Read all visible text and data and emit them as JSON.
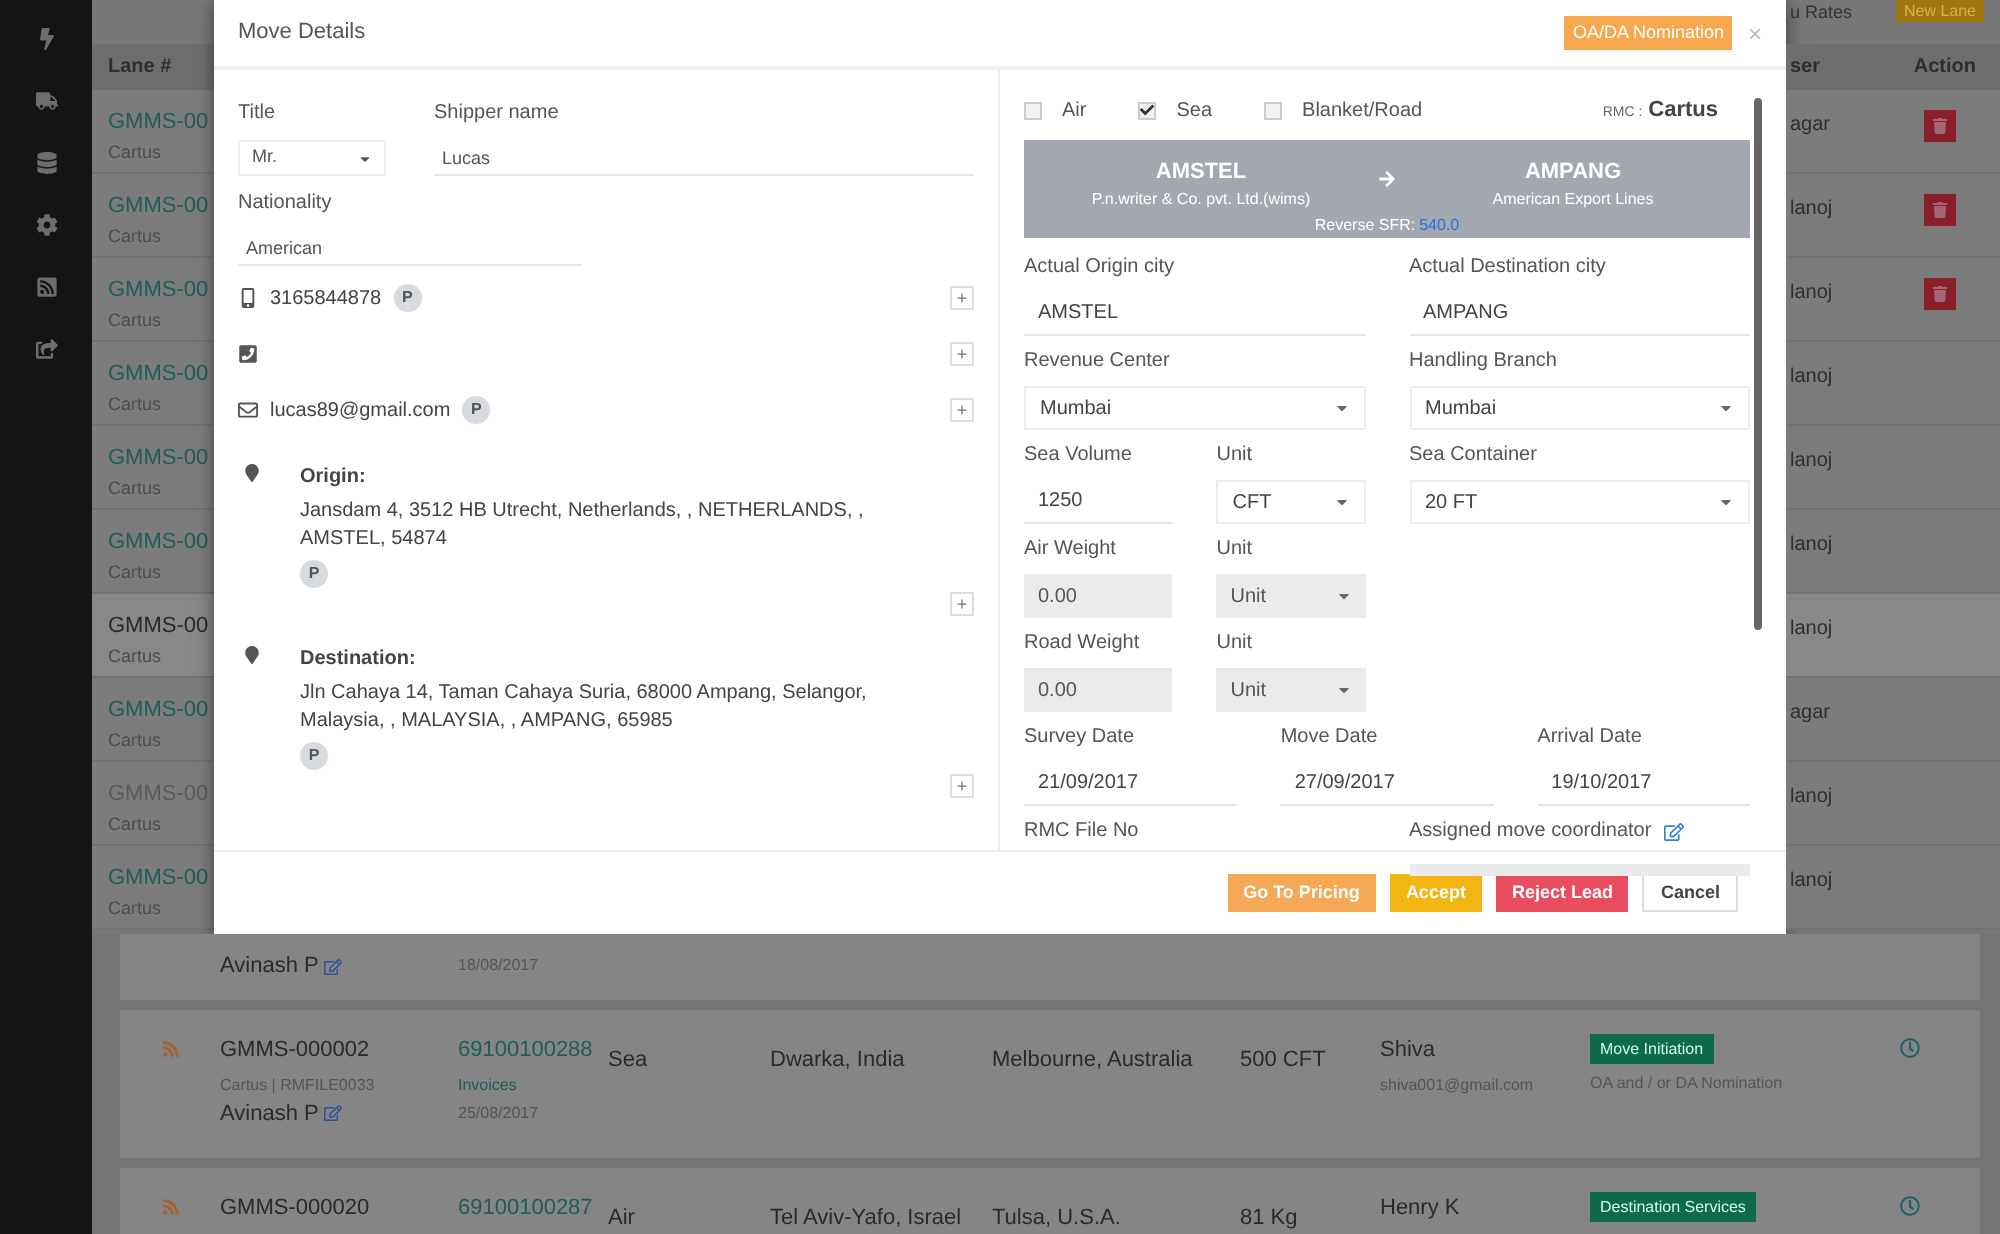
{
  "sidebar": {
    "icons": [
      {
        "kind": "bolt"
      },
      {
        "kind": "truck"
      },
      {
        "kind": "database"
      },
      {
        "kind": "settings"
      },
      {
        "kind": "rss"
      },
      {
        "kind": "share"
      }
    ]
  },
  "top_bar": {
    "rates_text": "u Rates",
    "new_button": "New Lane"
  },
  "background_table": {
    "lane_header": "Lane #",
    "user_header": "ser",
    "action_header": "Action",
    "rows": [
      {
        "lane": "GMMS-00",
        "rmc": "Cartus",
        "user": "agar",
        "kind": "link",
        "deletable": true
      },
      {
        "lane": "GMMS-00",
        "rmc": "Cartus",
        "user": "lanoj",
        "kind": "link",
        "deletable": true
      },
      {
        "lane": "GMMS-00",
        "rmc": "Cartus",
        "user": "lanoj",
        "kind": "link",
        "deletable": true
      },
      {
        "lane": "GMMS-00",
        "rmc": "Cartus",
        "user": "lanoj",
        "kind": "link",
        "deletable": false
      },
      {
        "lane": "GMMS-00",
        "rmc": "Cartus",
        "user": "lanoj",
        "kind": "link",
        "deletable": false
      },
      {
        "lane": "GMMS-00",
        "rmc": "Cartus",
        "user": "lanoj",
        "kind": "link",
        "deletable": false
      },
      {
        "lane": "GMMS-00",
        "rmc": "Cartus",
        "user": "lanoj",
        "kind": "highlight",
        "deletable": false
      },
      {
        "lane": "GMMS-00",
        "rmc": "Cartus",
        "user": "agar",
        "kind": "link",
        "deletable": false
      },
      {
        "lane": "GMMS-00",
        "rmc": "Cartus",
        "user": "lanoj",
        "kind": "muted",
        "deletable": false
      },
      {
        "lane": "GMMS-00",
        "rmc": "Cartus",
        "user": "lanoj",
        "kind": "link",
        "deletable": false
      }
    ]
  },
  "modal": {
    "title": "Move Details",
    "nomination_button": "OA/DA Nomination",
    "close": "×",
    "title_field": {
      "label": "Title",
      "value": "Mr."
    },
    "shipper_field": {
      "label": "Shipper name",
      "value": "Lucas"
    },
    "nationality_field": {
      "label": "Nationality",
      "value": "American"
    },
    "contacts": [
      {
        "kind": "mobile",
        "value": "3165844878",
        "primary": true,
        "primary_label": "P",
        "add": "+"
      },
      {
        "kind": "phone",
        "add": "+"
      },
      {
        "kind": "email",
        "value": "lucas89@gmail.com",
        "primary": true,
        "primary_label": "P",
        "add": "+"
      }
    ],
    "addresses": [
      {
        "label": "Origin:",
        "text": "Jansdam 4, 3512 HB Utrecht, Netherlands, , NETHERLANDS, , AMSTEL, 54874",
        "primary": true,
        "primary_label": "P",
        "add": "+"
      },
      {
        "label": "Destination:",
        "text": "Jln Cahaya 14, Taman Cahaya Suria, 68000 Ampang, Selangor, Malaysia, , MALAYSIA, , AMPANG, 65985",
        "primary": true,
        "primary_label": "P",
        "add": "+"
      }
    ],
    "modes": [
      {
        "label": "Air",
        "checked": false
      },
      {
        "label": "Sea",
        "checked": true
      },
      {
        "label": "Blanket/Road",
        "checked": false
      }
    ],
    "rmc": {
      "label": "RMC :",
      "value": "Cartus"
    },
    "route": {
      "origin_city": "AMSTEL",
      "origin_agent": "P.n.writer & Co. pvt. Ltd.(wims)",
      "destination_city": "AMPANG",
      "destination_agent": "American Export Lines",
      "sfr_label": "Reverse SFR:",
      "sfr_value": "540.0"
    },
    "field_rows": [
      {
        "kind": "even",
        "fields": [
          {
            "label": "Actual Origin city",
            "value": "AMSTEL",
            "kind": "input"
          },
          {
            "label": "Actual Destination city",
            "value": "AMPANG",
            "kind": "input"
          }
        ]
      },
      {
        "kind": "even",
        "fields": [
          {
            "label": "Revenue Center",
            "value": "Mumbai",
            "kind": "select"
          },
          {
            "label": "Handling Branch",
            "value": "Mumbai",
            "kind": "select"
          }
        ]
      },
      {
        "kind": "units",
        "fields": [
          {
            "label": "Sea Volume",
            "value": "1250",
            "kind": "input"
          },
          {
            "label": "Unit",
            "value": "CFT",
            "kind": "select"
          },
          {
            "label": "Sea Container",
            "value": "20 FT",
            "kind": "select"
          }
        ]
      },
      {
        "kind": "units",
        "fields": [
          {
            "label": "Air Weight",
            "value": "0.00",
            "kind": "input",
            "disabled": true
          },
          {
            "label": "Unit",
            "value": "Unit",
            "kind": "select",
            "disabled": true
          }
        ]
      },
      {
        "kind": "units",
        "fields": [
          {
            "label": "Road Weight",
            "value": "0.00",
            "kind": "input",
            "disabled": true
          },
          {
            "label": "Unit",
            "value": "Unit",
            "kind": "select",
            "disabled": true
          }
        ]
      },
      {
        "kind": "even",
        "fields": [
          {
            "label": "Survey Date",
            "value": "21/09/2017",
            "kind": "input"
          },
          {
            "label": "Move Date",
            "value": "27/09/2017",
            "kind": "input"
          },
          {
            "label": "Arrival Date",
            "value": "19/10/2017",
            "kind": "input"
          }
        ]
      },
      {
        "kind": "even",
        "fields": [
          {
            "label": "RMC File No",
            "kind": "label"
          },
          {
            "label": "Assigned move coordinator",
            "kind": "coordinator"
          }
        ]
      }
    ],
    "buttons": [
      {
        "label": "Go To Pricing",
        "kind": "pricing"
      },
      {
        "label": "Accept",
        "kind": "accept"
      },
      {
        "label": "Reject Lead",
        "kind": "reject"
      },
      {
        "label": "Cancel",
        "kind": "cancel"
      }
    ]
  },
  "bottom_rows": [
    {
      "coordinator": "Avinash P",
      "date": "18/08/2017",
      "partial": true
    },
    {
      "lane": "GMMS-000002",
      "rmc_file": "Cartus | RMFILE0033",
      "coordinator": "Avinash P",
      "invoice_no": "69100100288",
      "invoices": "Invoices",
      "date": "25/08/2017",
      "mode": "Sea",
      "from": "Dwarka, India",
      "to": "Melbourne, Australia",
      "volume": "500 CFT",
      "user": "Shiva",
      "email": "shiva001@gmail.com",
      "status": "Move Initiation",
      "sub_status": "OA and / or DA Nomination",
      "partial": false
    },
    {
      "lane": "GMMS-000020",
      "invoice_no": "69100100287",
      "mode": "Air",
      "from": "Tel Aviv-Yafo, Israel",
      "to": "Tulsa, U.S.A.",
      "volume": "81 Kg",
      "user": "Henry K",
      "status": "Destination Services",
      "partial": false
    }
  ]
}
